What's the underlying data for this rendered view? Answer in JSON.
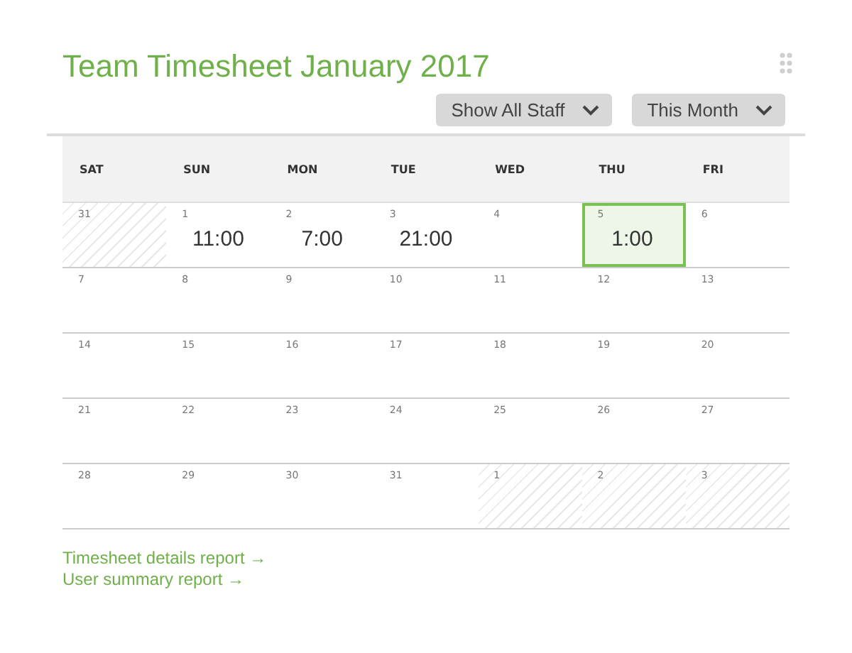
{
  "title": "Team Timesheet January 2017",
  "filters": [
    {
      "label": "Show All Staff"
    },
    {
      "label": "This Month"
    }
  ],
  "weekdays": [
    "SAT",
    "SUN",
    "MON",
    "TUE",
    "WED",
    "THU",
    "FRI"
  ],
  "weeks": [
    [
      {
        "day": "31",
        "outside": true,
        "selected": false
      },
      {
        "day": "1",
        "hours": "11:00",
        "outside": false,
        "selected": false
      },
      {
        "day": "2",
        "hours": "7:00",
        "outside": false,
        "selected": false
      },
      {
        "day": "3",
        "hours": "21:00",
        "outside": false,
        "selected": false
      },
      {
        "day": "4",
        "outside": false,
        "selected": false
      },
      {
        "day": "5",
        "hours": "1:00",
        "outside": false,
        "selected": true
      },
      {
        "day": "6",
        "outside": false,
        "selected": false
      }
    ],
    [
      {
        "day": "7",
        "outside": false,
        "selected": false
      },
      {
        "day": "8",
        "outside": false,
        "selected": false
      },
      {
        "day": "9",
        "outside": false,
        "selected": false
      },
      {
        "day": "10",
        "outside": false,
        "selected": false
      },
      {
        "day": "11",
        "outside": false,
        "selected": false
      },
      {
        "day": "12",
        "outside": false,
        "selected": false
      },
      {
        "day": "13",
        "outside": false,
        "selected": false
      }
    ],
    [
      {
        "day": "14",
        "outside": false,
        "selected": false
      },
      {
        "day": "15",
        "outside": false,
        "selected": false
      },
      {
        "day": "16",
        "outside": false,
        "selected": false
      },
      {
        "day": "17",
        "outside": false,
        "selected": false
      },
      {
        "day": "18",
        "outside": false,
        "selected": false
      },
      {
        "day": "19",
        "outside": false,
        "selected": false
      },
      {
        "day": "20",
        "outside": false,
        "selected": false
      }
    ],
    [
      {
        "day": "21",
        "outside": false,
        "selected": false
      },
      {
        "day": "22",
        "outside": false,
        "selected": false
      },
      {
        "day": "23",
        "outside": false,
        "selected": false
      },
      {
        "day": "24",
        "outside": false,
        "selected": false
      },
      {
        "day": "25",
        "outside": false,
        "selected": false
      },
      {
        "day": "26",
        "outside": false,
        "selected": false
      },
      {
        "day": "27",
        "outside": false,
        "selected": false
      }
    ],
    [
      {
        "day": "28",
        "outside": false,
        "selected": false
      },
      {
        "day": "29",
        "outside": false,
        "selected": false
      },
      {
        "day": "30",
        "outside": false,
        "selected": false
      },
      {
        "day": "31",
        "outside": false,
        "selected": false
      },
      {
        "day": "1",
        "outside": true,
        "selected": false
      },
      {
        "day": "2",
        "outside": true,
        "selected": false
      },
      {
        "day": "3",
        "outside": true,
        "selected": false
      }
    ]
  ],
  "links": [
    "Timesheet details report →",
    "User summary report →"
  ]
}
